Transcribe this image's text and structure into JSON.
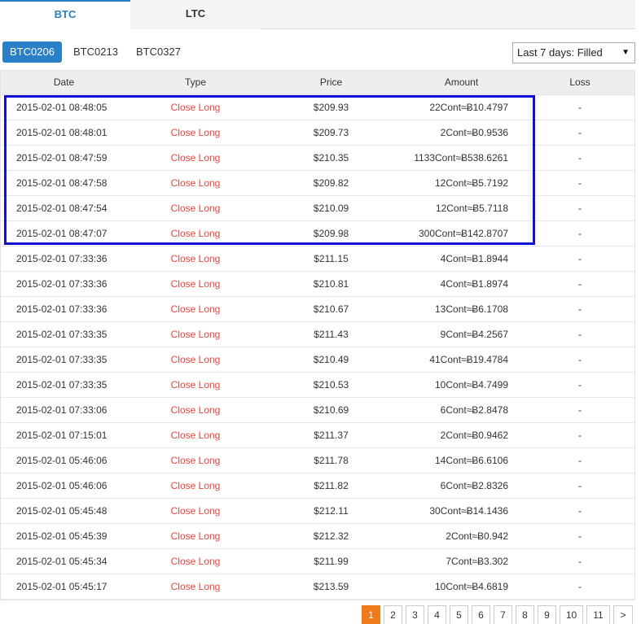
{
  "market_tabs": [
    {
      "label": "BTC",
      "active": true
    },
    {
      "label": "LTC",
      "active": false
    }
  ],
  "contract_tabs": [
    {
      "label": "BTC0206",
      "active": true
    },
    {
      "label": "BTC0213",
      "active": false
    },
    {
      "label": "BTC0327",
      "active": false
    }
  ],
  "filter": {
    "selected": "Last 7 days: Filled"
  },
  "table": {
    "columns": [
      "Date",
      "Type",
      "Price",
      "Amount",
      "Loss"
    ],
    "rows": [
      {
        "date": "2015-02-01 08:48:05",
        "type": "Close Long",
        "price": "$209.93",
        "amount": "22Cont≈Ƀ10.4797",
        "loss": "-"
      },
      {
        "date": "2015-02-01 08:48:01",
        "type": "Close Long",
        "price": "$209.73",
        "amount": "2Cont≈Ƀ0.9536",
        "loss": "-"
      },
      {
        "date": "2015-02-01 08:47:59",
        "type": "Close Long",
        "price": "$210.35",
        "amount": "1133Cont≈Ƀ538.6261",
        "loss": "-"
      },
      {
        "date": "2015-02-01 08:47:58",
        "type": "Close Long",
        "price": "$209.82",
        "amount": "12Cont≈Ƀ5.7192",
        "loss": "-"
      },
      {
        "date": "2015-02-01 08:47:54",
        "type": "Close Long",
        "price": "$210.09",
        "amount": "12Cont≈Ƀ5.7118",
        "loss": "-"
      },
      {
        "date": "2015-02-01 08:47:07",
        "type": "Close Long",
        "price": "$209.98",
        "amount": "300Cont≈Ƀ142.8707",
        "loss": "-"
      },
      {
        "date": "2015-02-01 07:33:36",
        "type": "Close Long",
        "price": "$211.15",
        "amount": "4Cont≈Ƀ1.8944",
        "loss": "-"
      },
      {
        "date": "2015-02-01 07:33:36",
        "type": "Close Long",
        "price": "$210.81",
        "amount": "4Cont≈Ƀ1.8974",
        "loss": "-"
      },
      {
        "date": "2015-02-01 07:33:36",
        "type": "Close Long",
        "price": "$210.67",
        "amount": "13Cont≈Ƀ6.1708",
        "loss": "-"
      },
      {
        "date": "2015-02-01 07:33:35",
        "type": "Close Long",
        "price": "$211.43",
        "amount": "9Cont≈Ƀ4.2567",
        "loss": "-"
      },
      {
        "date": "2015-02-01 07:33:35",
        "type": "Close Long",
        "price": "$210.49",
        "amount": "41Cont≈Ƀ19.4784",
        "loss": "-"
      },
      {
        "date": "2015-02-01 07:33:35",
        "type": "Close Long",
        "price": "$210.53",
        "amount": "10Cont≈Ƀ4.7499",
        "loss": "-"
      },
      {
        "date": "2015-02-01 07:33:06",
        "type": "Close Long",
        "price": "$210.69",
        "amount": "6Cont≈Ƀ2.8478",
        "loss": "-"
      },
      {
        "date": "2015-02-01 07:15:01",
        "type": "Close Long",
        "price": "$211.37",
        "amount": "2Cont≈Ƀ0.9462",
        "loss": "-"
      },
      {
        "date": "2015-02-01 05:46:06",
        "type": "Close Long",
        "price": "$211.78",
        "amount": "14Cont≈Ƀ6.6106",
        "loss": "-"
      },
      {
        "date": "2015-02-01 05:46:06",
        "type": "Close Long",
        "price": "$211.82",
        "amount": "6Cont≈Ƀ2.8326",
        "loss": "-"
      },
      {
        "date": "2015-02-01 05:45:48",
        "type": "Close Long",
        "price": "$212.11",
        "amount": "30Cont≈Ƀ14.1436",
        "loss": "-"
      },
      {
        "date": "2015-02-01 05:45:39",
        "type": "Close Long",
        "price": "$212.32",
        "amount": "2Cont≈Ƀ0.942",
        "loss": "-"
      },
      {
        "date": "2015-02-01 05:45:34",
        "type": "Close Long",
        "price": "$211.99",
        "amount": "7Cont≈Ƀ3.302",
        "loss": "-"
      },
      {
        "date": "2015-02-01 05:45:17",
        "type": "Close Long",
        "price": "$213.59",
        "amount": "10Cont≈Ƀ4.6819",
        "loss": "-"
      }
    ]
  },
  "pagination": {
    "pages": [
      "1",
      "2",
      "3",
      "4",
      "5",
      "6",
      "7",
      "8",
      "9",
      "10",
      "11",
      ">"
    ],
    "current": "1"
  },
  "colors": {
    "accent": "#2a7fc9",
    "type_text": "#e8453c",
    "page_active": "#f07b1d",
    "highlight_border": "#1010d8"
  }
}
